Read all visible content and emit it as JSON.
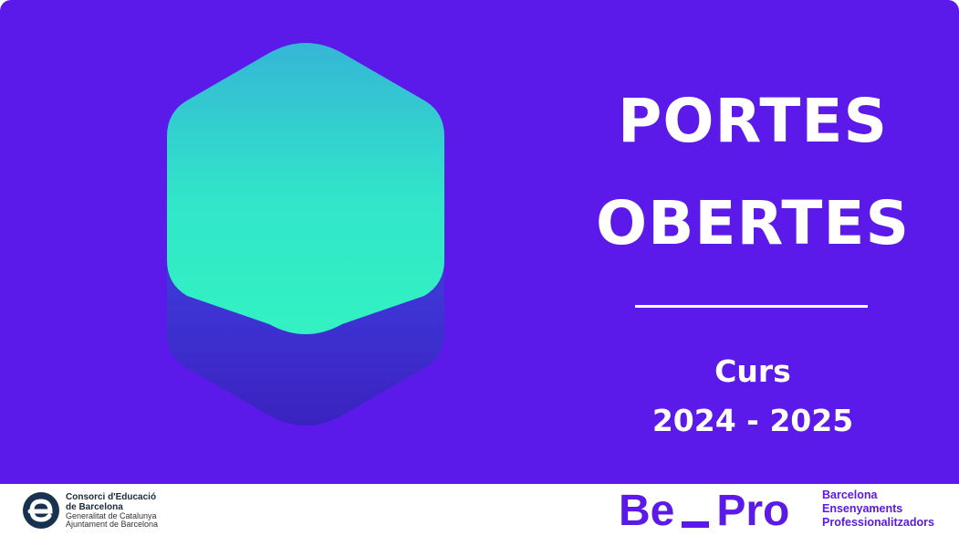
{
  "banner": {
    "title_line_1": "PORTES",
    "title_line_2": "OBERTES",
    "course_label": "Curs",
    "course_years": "2024 - 2025",
    "background_color": "#5b19ea"
  },
  "graphic": {
    "icon": "hexagon-cube-icon",
    "top_gradient": [
      "#35b6d6",
      "#33f2c2"
    ],
    "bottom_gradient": [
      "#3d47f0",
      "#3a2acb"
    ]
  },
  "footer": {
    "consorci_logo_icon": "consorci-e-logo-icon",
    "consorci_line_1": "Consorci d'Educació",
    "consorci_line_2": "de Barcelona",
    "consorci_line_3": "Generalitat de Catalunya",
    "consorci_line_4": "Ajuntament de Barcelona",
    "bepro_left": "Be",
    "bepro_right": "Pro",
    "bepro_line_1": "Barcelona",
    "bepro_line_2": "Ensenyaments",
    "bepro_line_3": "Professionalitzadors",
    "brand_color": "#5b19ea"
  }
}
